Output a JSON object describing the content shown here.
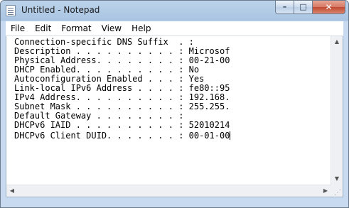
{
  "window": {
    "title": "Untitled - Notepad",
    "caption": {
      "minimize": "–",
      "maximize": "□",
      "close": "✕"
    }
  },
  "menu": [
    "File",
    "Edit",
    "Format",
    "View",
    "Help"
  ],
  "editor": {
    "lines": [
      "Connection-specific DNS Suffix  . :",
      "Description . . . . . . . . . . : Microsof",
      "Physical Address. . . . . . . . : 00-21-00",
      "DHCP Enabled. . . . . . . . . . : No",
      "Autoconfiguration Enabled . . . : Yes",
      "Link-local IPv6 Address . . . . : fe80::95",
      "IPv4 Address. . . . . . . . . . : 192.168.",
      "Subnet Mask . . . . . . . . . . : 255.255.",
      "Default Gateway . . . . . . . . :",
      "DHCPv6 IAID . . . . . . . . . . : 52010214",
      "DHCPv6 Client DUID. . . . . . . : 00-01-00"
    ]
  },
  "scrollbars": {
    "up": "▲",
    "down": "▼",
    "left": "◀",
    "right": "▶"
  }
}
